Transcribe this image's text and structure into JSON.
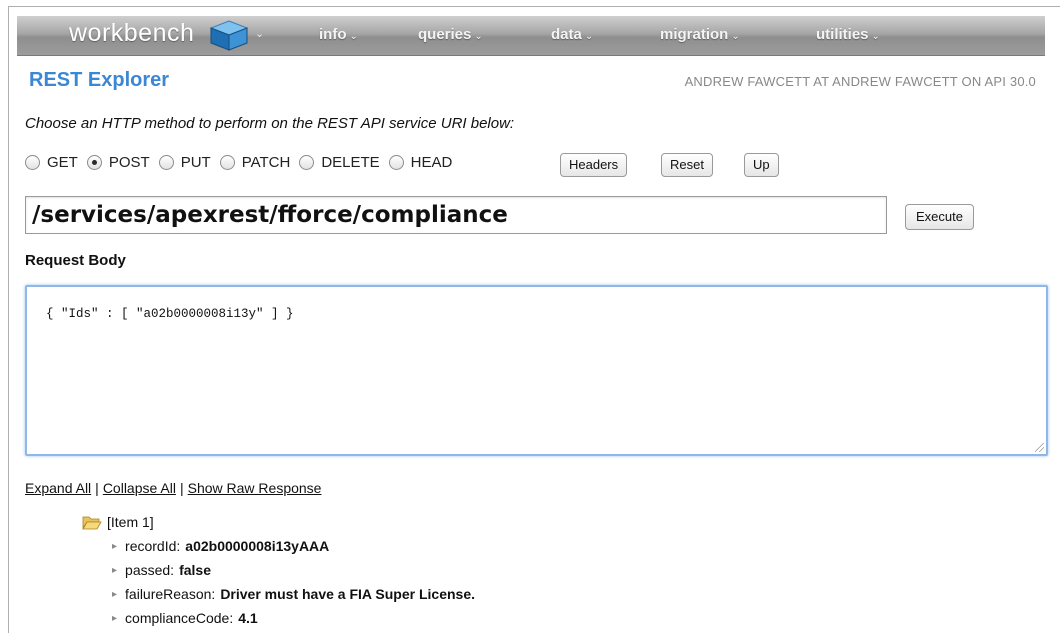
{
  "nav": {
    "logo": "workbench",
    "items": [
      {
        "label": "info"
      },
      {
        "label": "queries"
      },
      {
        "label": "data"
      },
      {
        "label": "migration"
      },
      {
        "label": "utilities"
      }
    ],
    "caret": "⌄"
  },
  "header": {
    "title": "REST Explorer",
    "user_info": "ANDREW FAWCETT AT ANDREW FAWCETT ON API 30.0"
  },
  "instructions": "Choose an HTTP method to perform on the REST API service URI below:",
  "methods": [
    {
      "label": "GET",
      "checked": false
    },
    {
      "label": "POST",
      "checked": true
    },
    {
      "label": "PUT",
      "checked": false
    },
    {
      "label": "PATCH",
      "checked": false
    },
    {
      "label": "DELETE",
      "checked": false
    },
    {
      "label": "HEAD",
      "checked": false
    }
  ],
  "buttons": {
    "headers": "Headers",
    "reset": "Reset",
    "up": "Up",
    "execute": "Execute"
  },
  "uri": "/services/apexrest/fforce/compliance",
  "request_body": {
    "label": "Request Body",
    "value": "{ \"Ids\" : [ \"a02b0000008i13y\" ] }"
  },
  "links": {
    "expand_all": "Expand All",
    "collapse_all": "Collapse All",
    "show_raw": "Show Raw Response",
    "separator": "|"
  },
  "tree": {
    "root": "[Item 1]",
    "fields": [
      {
        "key": "recordId:",
        "value": "a02b0000008i13yAAA"
      },
      {
        "key": "passed:",
        "value": "false"
      },
      {
        "key": "failureReason:",
        "value": "Driver must have a FIA Super License."
      },
      {
        "key": "complianceCode:",
        "value": "4.1"
      }
    ]
  },
  "colors": {
    "title_blue": "#3b87d3",
    "navbar_gray": "#9d9d9d",
    "focus_blue": "#8fb8e6"
  }
}
